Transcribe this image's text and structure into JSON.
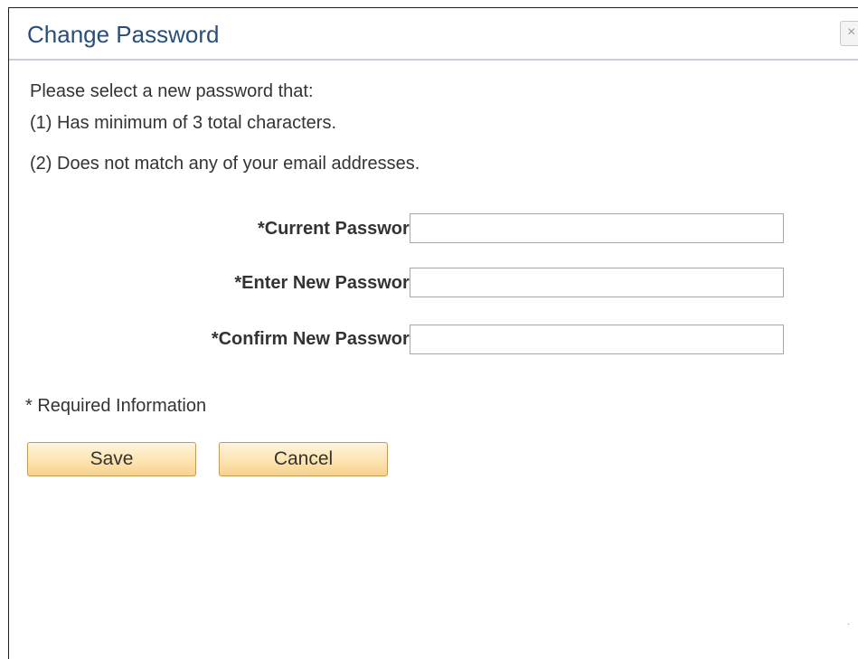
{
  "dialog": {
    "title": "Change Password",
    "close_label": "×"
  },
  "instructions": [
    "Please select a new password that:",
    "(1) Has minimum of 3 total characters.",
    "(2) Does not match any of your email addresses."
  ],
  "form": {
    "current_password_label": "*Current Password",
    "current_password_value": "",
    "new_password_label": "*Enter New Password",
    "new_password_value": "",
    "confirm_password_label": "*Confirm New Password",
    "confirm_password_value": ""
  },
  "required_note": "* Required Information",
  "buttons": {
    "save_label": "Save",
    "cancel_label": "Cancel"
  },
  "colors": {
    "title": "#2a4e7a",
    "button_top": "#fff4dc",
    "button_bottom": "#f7d28d",
    "button_border": "#c79853"
  }
}
